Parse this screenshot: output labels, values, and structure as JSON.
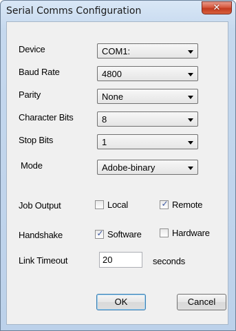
{
  "window": {
    "title": "Serial Comms Configuration",
    "close_glyph": "✕"
  },
  "fields": {
    "device": {
      "label": "Device",
      "value": "COM1:"
    },
    "baud_rate": {
      "label": "Baud Rate",
      "value": "4800"
    },
    "parity": {
      "label": "Parity",
      "value": "None"
    },
    "character_bits": {
      "label": "Character Bits",
      "value": "8"
    },
    "stop_bits": {
      "label": "Stop Bits",
      "value": "1"
    },
    "mode": {
      "label": "Mode",
      "value": "Adobe-binary"
    }
  },
  "job_output": {
    "label": "Job Output",
    "local": {
      "label": "Local",
      "checked": false
    },
    "remote": {
      "label": "Remote",
      "checked": true
    }
  },
  "handshake": {
    "label": "Handshake",
    "software": {
      "label": "Software",
      "checked": true
    },
    "hardware": {
      "label": "Hardware",
      "checked": false
    }
  },
  "link_timeout": {
    "label": "Link Timeout",
    "value": "20",
    "unit": "seconds"
  },
  "buttons": {
    "ok": "OK",
    "cancel": "Cancel"
  },
  "icons": {
    "dropdown": "chevron-down-icon",
    "check": "checkmark-icon",
    "close": "close-icon"
  }
}
